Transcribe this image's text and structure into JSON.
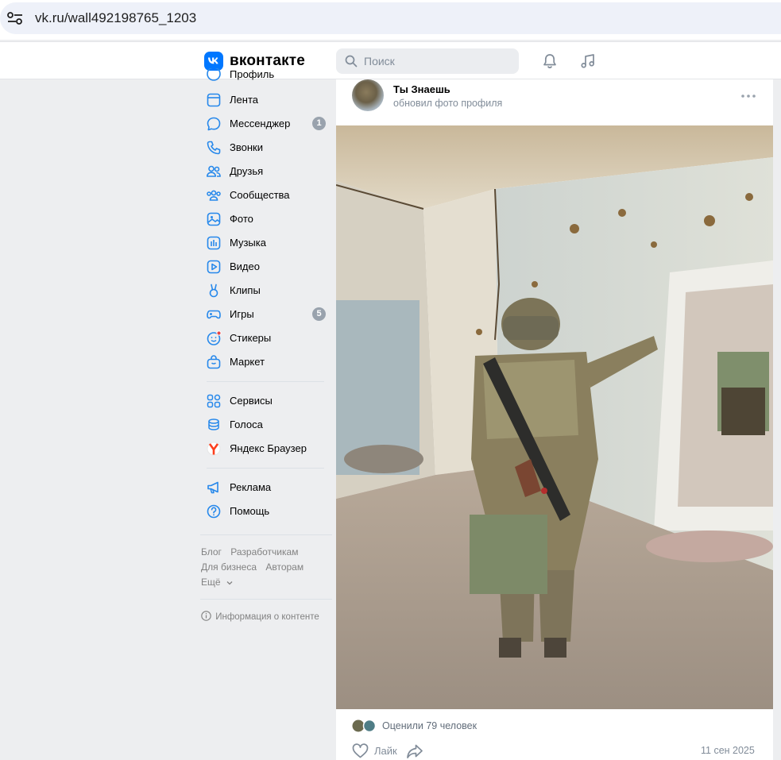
{
  "browser": {
    "url": "vk.ru/wall492198765_1203"
  },
  "header": {
    "logo_text": "вконтакте",
    "search_placeholder": "Поиск",
    "brand_color": "#0077ff"
  },
  "sidebar": {
    "partial_top_label": "Профиль",
    "items": [
      {
        "label": "Лента",
        "icon": "news-feed-icon"
      },
      {
        "label": "Мессенджер",
        "icon": "messenger-icon",
        "count": "1"
      },
      {
        "label": "Звонки",
        "icon": "phone-icon"
      },
      {
        "label": "Друзья",
        "icon": "friends-icon"
      },
      {
        "label": "Сообщества",
        "icon": "communities-icon"
      },
      {
        "label": "Фото",
        "icon": "photo-icon"
      },
      {
        "label": "Музыка",
        "icon": "music-icon"
      },
      {
        "label": "Видео",
        "icon": "video-icon"
      },
      {
        "label": "Клипы",
        "icon": "clips-icon"
      },
      {
        "label": "Игры",
        "icon": "games-icon",
        "count": "5"
      },
      {
        "label": "Стикеры",
        "icon": "stickers-icon"
      },
      {
        "label": "Маркет",
        "icon": "market-icon"
      }
    ],
    "items2": [
      {
        "label": "Сервисы",
        "icon": "services-icon"
      },
      {
        "label": "Голоса",
        "icon": "votes-icon"
      },
      {
        "label": "Яндекс Браузер",
        "icon": "yandex-browser-icon"
      }
    ],
    "items3": [
      {
        "label": "Реклама",
        "icon": "ads-icon"
      },
      {
        "label": "Помощь",
        "icon": "help-icon"
      }
    ],
    "footer": {
      "blog": "Блог",
      "developers": "Разработчикам",
      "business": "Для бизнеса",
      "authors": "Авторам",
      "more": "Ещё",
      "content_info": "Информация о контенте"
    }
  },
  "post": {
    "author": "Ты Знаешь",
    "action": "обновил фото профиля",
    "likes_text": "Оценили 79 человек",
    "like_label": "Лайк",
    "date": "11 сен 2025"
  }
}
